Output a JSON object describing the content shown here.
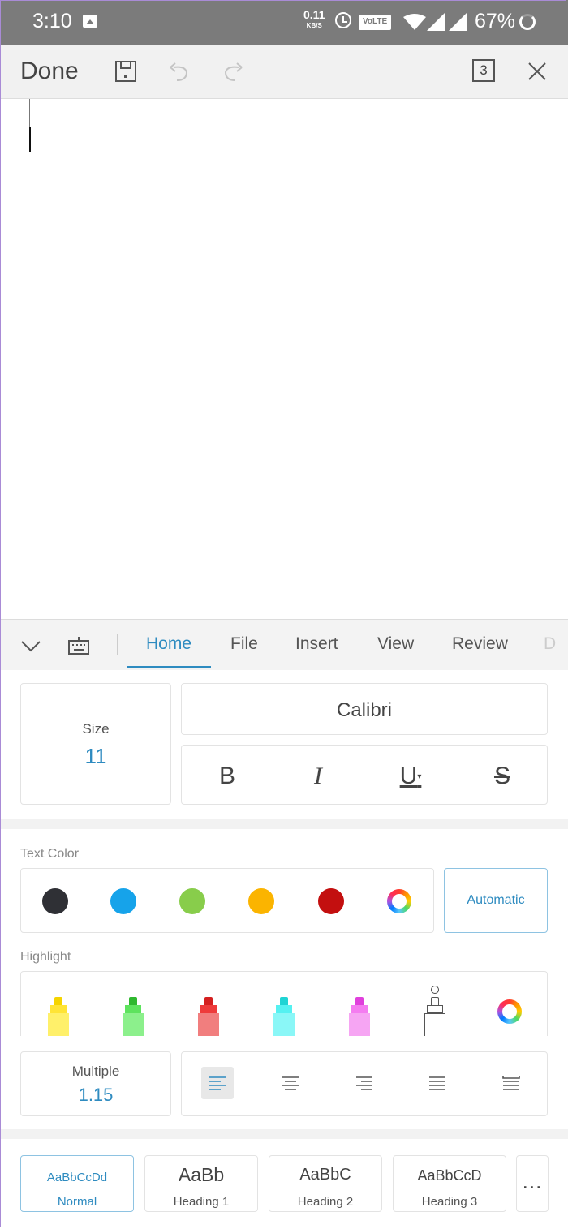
{
  "status_bar": {
    "time": "3:10",
    "speed_value": "0.11",
    "speed_unit": "KB/S",
    "volte": "VoLTE",
    "battery_percent": "67%",
    "background": "#7b7b7b"
  },
  "toolbar": {
    "done_label": "Done",
    "pages_count": "3",
    "icons": [
      "save-icon",
      "undo-icon",
      "redo-icon",
      "pages-icon",
      "close-icon"
    ]
  },
  "ribbon": {
    "tabs": [
      {
        "label": "Home",
        "active": true
      },
      {
        "label": "File",
        "active": false
      },
      {
        "label": "Insert",
        "active": false
      },
      {
        "label": "View",
        "active": false
      },
      {
        "label": "Review",
        "active": false
      },
      {
        "label": "D",
        "active": false
      }
    ],
    "accent_color": "#2e8bc0"
  },
  "home": {
    "size_label": "Size",
    "size_value": "11",
    "font_name": "Calibri",
    "format_buttons": [
      "B",
      "I",
      "U",
      "S"
    ],
    "text_color_label": "Text Color",
    "text_colors": [
      "#2f3035",
      "#16a3ea",
      "#88cd4b",
      "#fbb400",
      "#c30f0f"
    ],
    "automatic_label": "Automatic",
    "highlight_label": "Highlight",
    "highlight_colors": [
      "#ffe436",
      "#5ee35e",
      "#ee3b3b",
      "#55f1f1",
      "#f47cf0"
    ],
    "spacing_label": "Multiple",
    "spacing_value": "1.15",
    "alignments": [
      "align-left",
      "align-center",
      "align-right",
      "justify",
      "distributed"
    ],
    "styles": [
      {
        "sample": "AaBbCcDd",
        "name": "Normal",
        "active": true
      },
      {
        "sample": "AaBb",
        "name": "Heading 1",
        "active": false
      },
      {
        "sample": "AaBbC",
        "name": "Heading 2",
        "active": false
      },
      {
        "sample": "AaBbCcD",
        "name": "Heading 3",
        "active": false
      }
    ],
    "more_label": "..."
  }
}
